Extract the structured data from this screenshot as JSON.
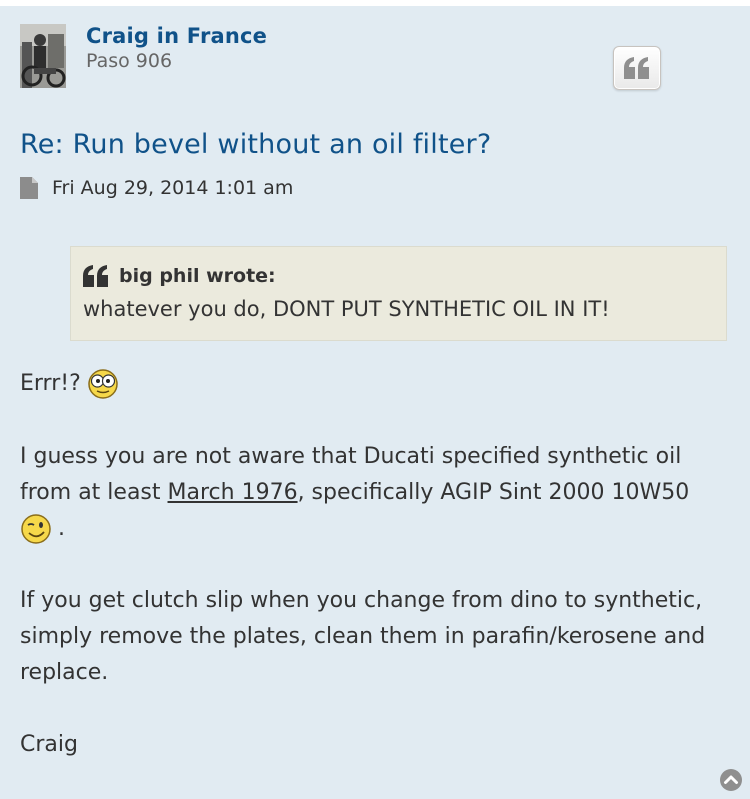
{
  "post": {
    "author": "Craig in France",
    "rank": "Paso 906",
    "title": "Re: Run bevel without an oil filter?",
    "date": "Fri Aug 29, 2014 1:01 am"
  },
  "quote": {
    "cite": "big phil wrote:",
    "text": "whatever you do, DONT PUT SYNTHETIC OIL IN IT!"
  },
  "body": {
    "p1": "Errr!?",
    "p2_before": "I guess you are not aware that Ducati specified synthetic oil from at least ",
    "p2_link": "March 1976",
    "p2_after": ", specifically AGIP Sint 2000 10W50",
    "p2_end": ".",
    "p3": "If you get clutch slip when you change from dino to synthetic, simply remove the plates, clean them in parafin/kerosene and replace.",
    "p4": "Craig"
  },
  "icons": {
    "quote_button": "quote-icon",
    "post_link": "document-icon",
    "smiley_1": "eek-smiley",
    "smiley_2": "wink-smiley",
    "back_to_top": "chevron-up-circle-icon"
  },
  "colors": {
    "accent": "#105289",
    "post_bg": "#e1ebf2",
    "quote_bg": "#ebeadd"
  }
}
